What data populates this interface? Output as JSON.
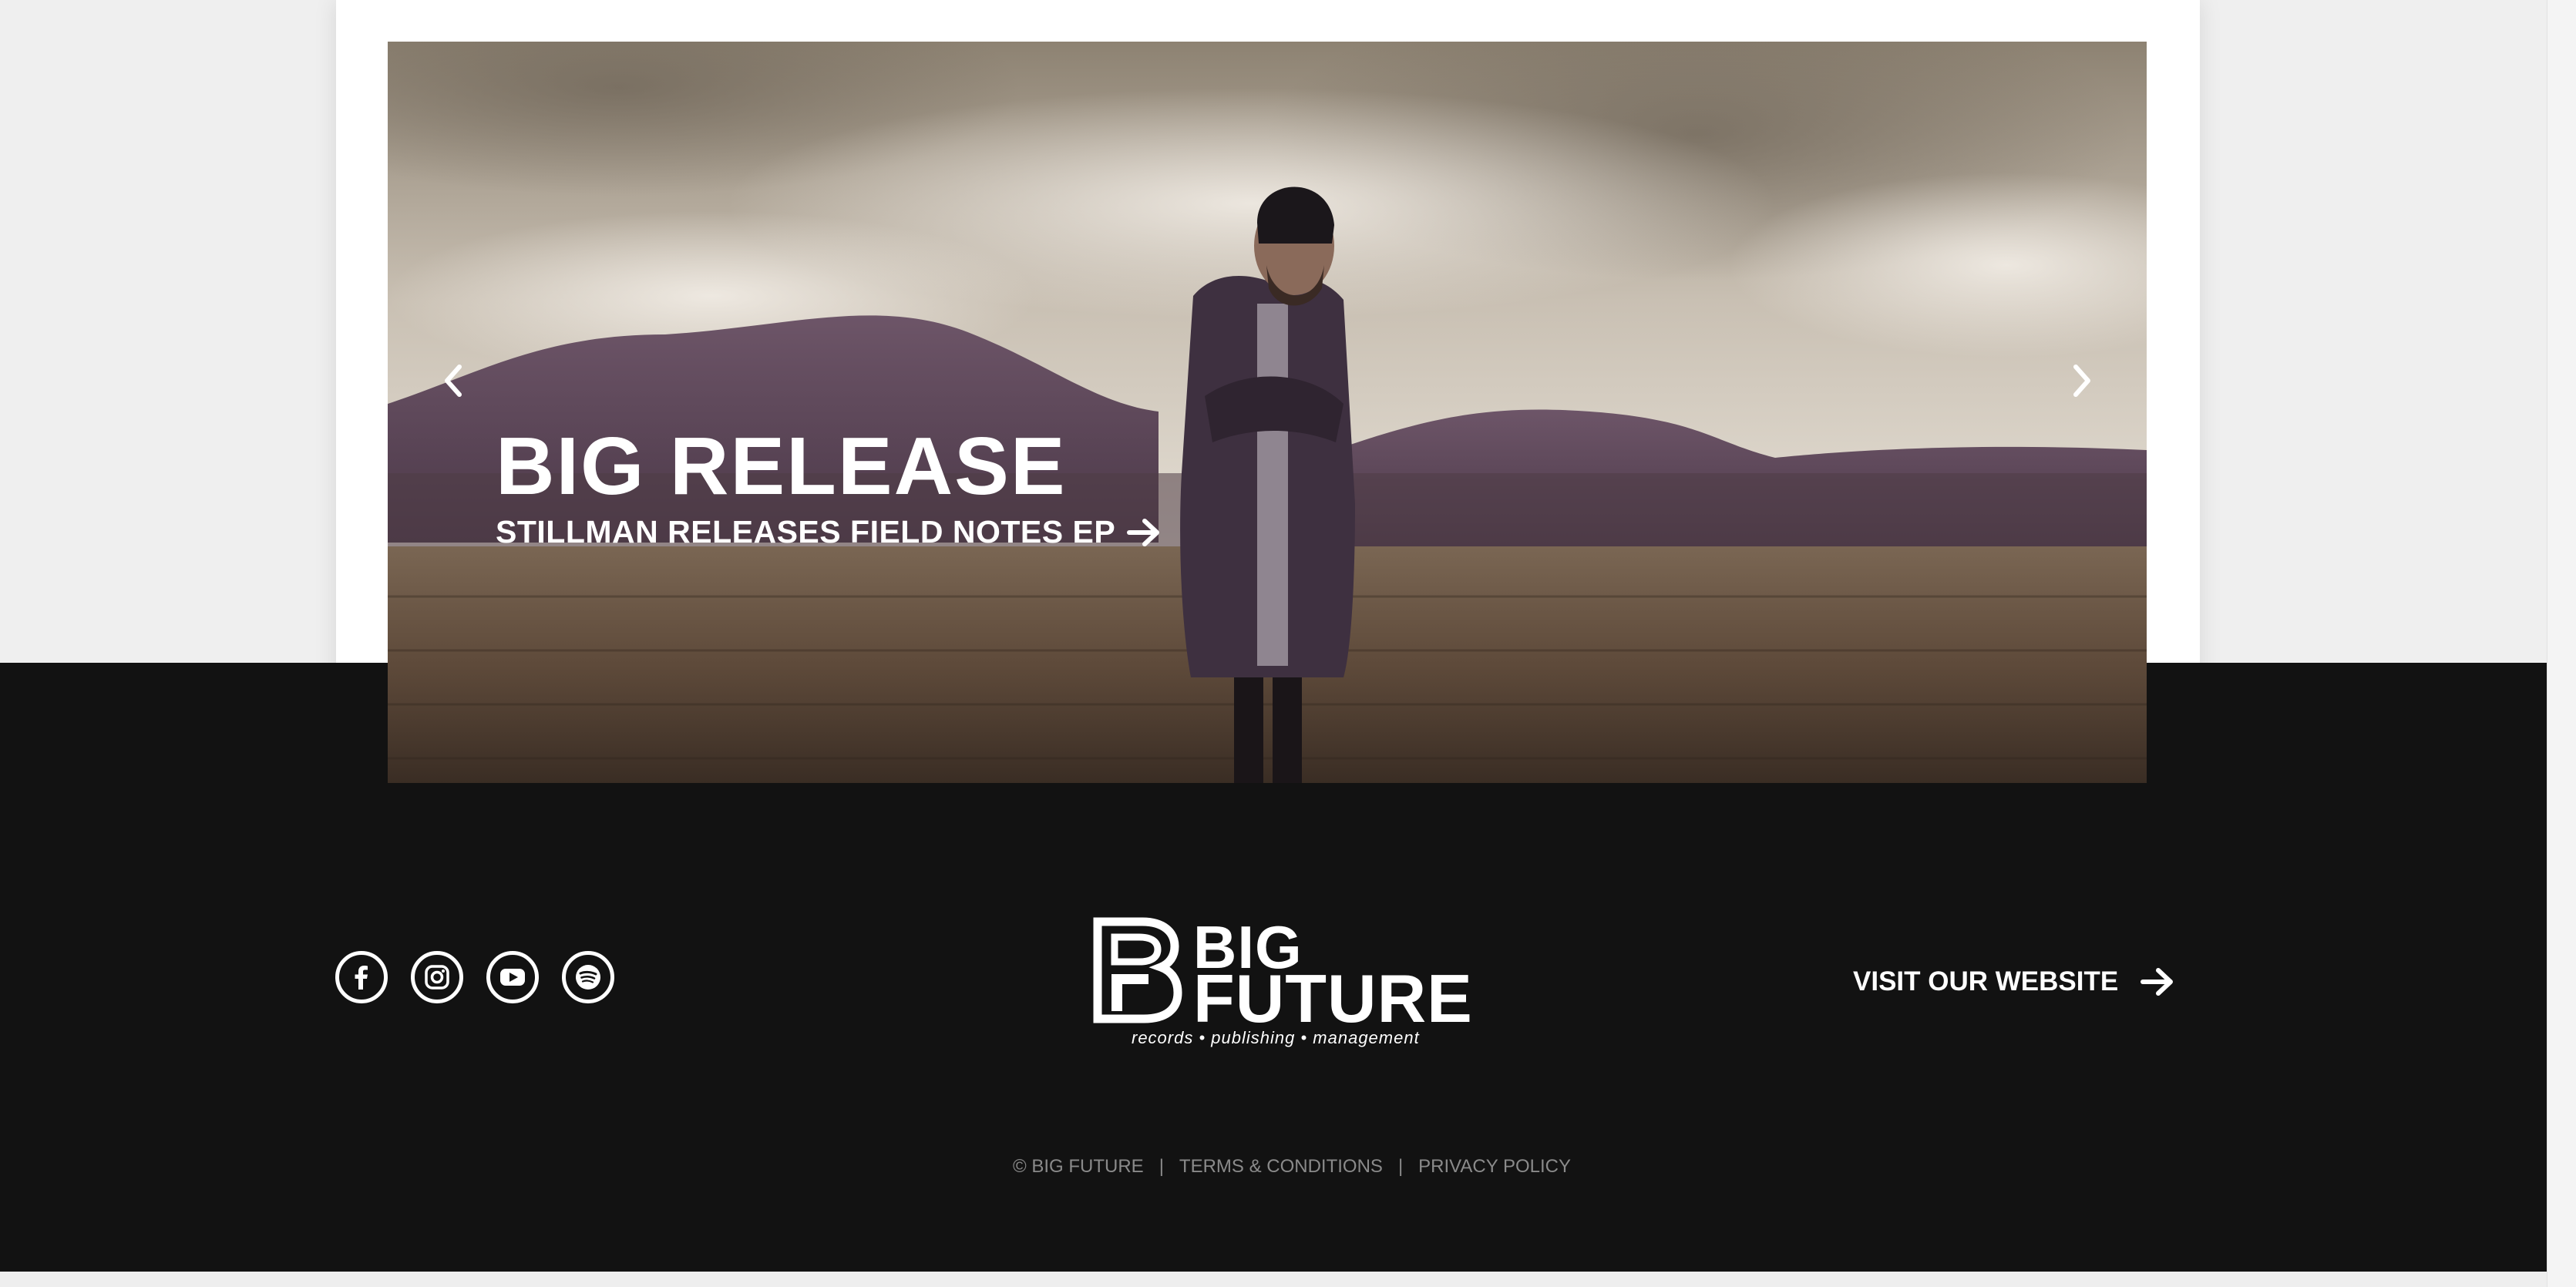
{
  "colors": {
    "page_bg": "#efefef",
    "card_bg": "#ffffff",
    "footer_bg": "#121212",
    "text_light": "#ffffff",
    "text_muted": "#8a8a8a"
  },
  "hero": {
    "title": "BIG RELEASE",
    "link_label": "STILLMAN RELEASES FIELD NOTES EP",
    "prev_icon": "chevron-left-icon",
    "next_icon": "chevron-right-icon",
    "link_icon": "arrow-right-icon"
  },
  "footer": {
    "social": [
      {
        "name": "facebook",
        "icon": "facebook-icon"
      },
      {
        "name": "instagram",
        "icon": "instagram-icon"
      },
      {
        "name": "youtube",
        "icon": "youtube-icon"
      },
      {
        "name": "spotify",
        "icon": "spotify-icon"
      }
    ],
    "logo": {
      "line1": "BIG",
      "line2": "FUTURE",
      "tagline": "records • publishing • management"
    },
    "visit_label": "VISIT OUR WEBSITE",
    "legal": {
      "copyright": "© BIG FUTURE",
      "separator": "|",
      "terms": "TERMS & CONDITIONS",
      "privacy": "PRIVACY POLICY"
    }
  }
}
